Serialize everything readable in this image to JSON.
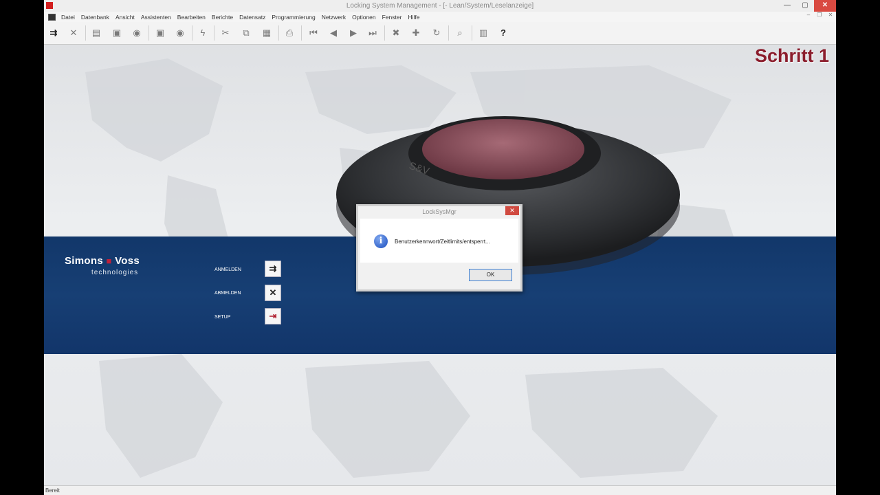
{
  "window": {
    "title": "Locking System Management - [- Lean/System/Leselanzeige]",
    "minimize": "—",
    "maximize": "▢",
    "close": "✕"
  },
  "menu": [
    "Datei",
    "Datenbank",
    "Ansicht",
    "Assistenten",
    "Bearbeiten",
    "Berichte",
    "Datensatz",
    "Programmierung",
    "Netzwerk",
    "Optionen",
    "Fenster",
    "Hilfe"
  ],
  "banner": {
    "step": "Schritt 1"
  },
  "brand": {
    "name_left": "Simons",
    "name_right": "Voss",
    "tagline": "technologies"
  },
  "actions": [
    {
      "label": "ANMELDEN",
      "icon": "login-icon"
    },
    {
      "label": "ABMELDEN",
      "icon": "logout-icon"
    },
    {
      "label": "SETUP",
      "icon": "setup-icon"
    }
  ],
  "dialog": {
    "title": "LockSysMgr",
    "message": "Benutzerkennwort/Zeitlimits/entsperrt...",
    "ok": "OK"
  },
  "status": {
    "text": "Bereit"
  },
  "colors": {
    "accent": "#8b1d2c",
    "band": "#173f74",
    "close": "#d04a40"
  }
}
